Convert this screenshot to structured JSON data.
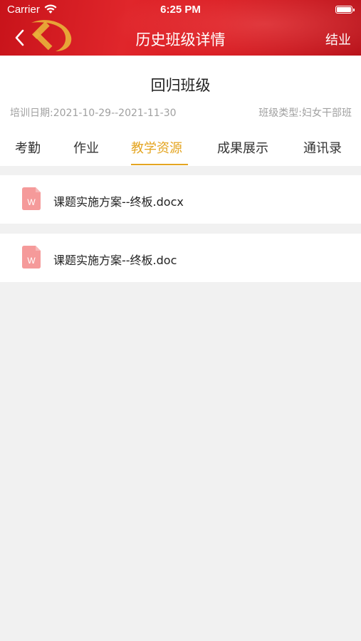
{
  "status_bar": {
    "carrier": "Carrier",
    "time": "6:25 PM"
  },
  "nav": {
    "title": "历史班级详情",
    "right_action": "结业"
  },
  "class_info": {
    "name": "回归班级",
    "training_date": "培训日期:2021-10-29--2021-11-30",
    "class_type": "班级类型:妇女干部班"
  },
  "tabs": [
    {
      "label": "考勤"
    },
    {
      "label": "作业"
    },
    {
      "label": "教学资源",
      "active": true
    },
    {
      "label": "成果展示"
    },
    {
      "label": "通讯录"
    }
  ],
  "files": [
    {
      "name": "课题实施方案--终板.docx",
      "icon": "word-file-icon"
    },
    {
      "name": "课题实施方案--终板.doc",
      "icon": "word-file-icon"
    }
  ],
  "colors": {
    "header_red": "#d91a20",
    "accent": "#e4a521",
    "file_icon": "#f59a9a"
  }
}
